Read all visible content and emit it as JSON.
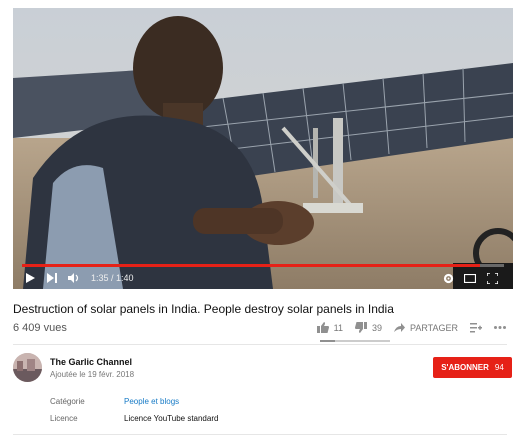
{
  "player": {
    "time": "1:35 / 1:40",
    "progress": 0.95,
    "icons": [
      "play-icon",
      "next-icon",
      "volume-icon",
      "settings-icon",
      "theater-icon",
      "fullscreen-icon"
    ]
  },
  "video": {
    "title": "Destruction of solar panels in India. People destroy solar panels in India",
    "views": "6 409 vues",
    "likes": "11",
    "dislikes": "39",
    "like_ratio": 0.22,
    "share_label": "PARTAGER"
  },
  "channel": {
    "name": "The Garlic Channel",
    "date": "Ajoutée le 19 févr. 2018",
    "subscribe_label": "S'ABONNER",
    "subscriber_count": "94"
  },
  "meta": {
    "category_label": "Catégorie",
    "category_value": "People et blogs",
    "license_label": "Licence",
    "license_value": "Licence YouTube standard"
  },
  "colors": {
    "accent": "#e62117",
    "link": "#167ac6"
  }
}
